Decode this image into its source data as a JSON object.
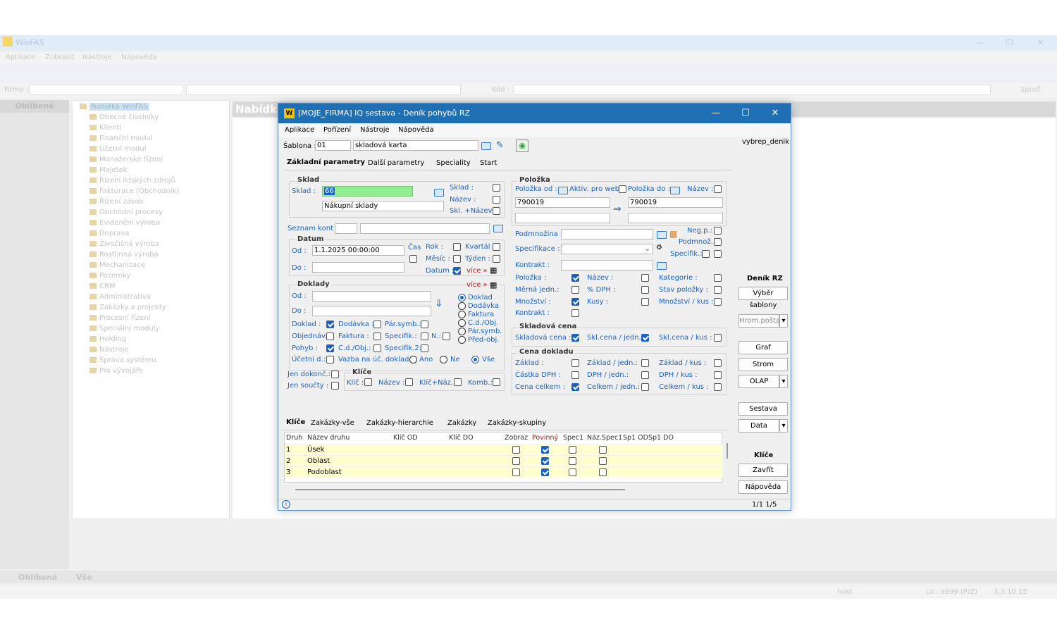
{
  "bg": {
    "title": "WinFAS",
    "menu": [
      "Aplikace",
      "Zobrazit",
      "Nástroje",
      "Nápověda"
    ],
    "firma_label": "Firma :",
    "kod_label": "Kód :",
    "spust": "Spusť",
    "oblibene": "Oblíbené",
    "nabidka": "Nabídka",
    "tree_root": "Nabídka WinFAS",
    "tree": [
      "Obecné číselníky",
      "Klienti",
      "Finanční modul",
      "Účetní modul",
      "Manažerské řízení",
      "Majetek",
      "Řízení lidských zdrojů",
      "Fakturace (Obchodník)",
      "Řízení zásob",
      "Obchodní procesy",
      "Evidenční výroba",
      "Doprava",
      "Živočišná výroba",
      "Rostlinná výroba",
      "Mechanizace",
      "Pozemky",
      "CRM",
      "Administrativa",
      "Zakázky a projekty",
      "Procesní řízení",
      "Speciální moduly",
      "Holding",
      "Nástroje",
      "Správa systému",
      "Pro vývojáře"
    ],
    "footer_left": "Oblíbené",
    "footer_all": "Vše",
    "host": "host",
    "lic": "Lic: 9999 (P/Z)",
    "version": "3.3.10.15"
  },
  "dlg": {
    "title": "[MOJE_FIRMA] IQ sestava - Deník pohybů RZ",
    "menu": [
      "Aplikace",
      "Pořízení",
      "Nástroje",
      "Nápověda"
    ],
    "sablona_label": "Šablona :",
    "sablona_code": "01",
    "sablona_name": "skladová karta",
    "right_code": "vybrep_denik",
    "tabs": [
      "Základní parametry",
      "Další parametry",
      "Speciality",
      "Start"
    ],
    "sklad_group": "Sklad",
    "sklad_label": "Sklad :",
    "sklad_value": "66",
    "sklad_name": "Nákupní sklady",
    "sklad_cb": "Sklad :",
    "nazev_cb": "Název :",
    "sklnazev_cb": "Skl. +Název :",
    "seznam_kont": "Seznam kont :",
    "datum_group": "Datum",
    "od": "Od :",
    "od_value": "1.1.2025 00:00:00",
    "cas": "Čas",
    "do": "Do :",
    "rok": "Rok :",
    "kvartal": "Kvartál :",
    "mesic": "Měsíc :",
    "tyden": "Týden :",
    "datum_cb": "Datum :",
    "vice": "více »",
    "doklady_group": "Doklady",
    "d_od": "Od :",
    "d_do": "Do :",
    "doklad_cb": "Doklad :",
    "dodavka_cb": "Dodávka :",
    "parsymb_cb": "Pár.symb.:",
    "objednav_cb": "Objednáv.:",
    "faktura_cb": "Faktura :",
    "specifik_cb": "Specifik.:",
    "n_cb": "N.:",
    "pohyb_cb": "Pohyb :",
    "cdobj_cb": "C.d./Obj.:",
    "specifik2_cb": "Specifik.2:",
    "ucetni_cb": "Účetní d.:",
    "vazba": "Vazba na úč. doklad :",
    "ano": "Ano",
    "ne": "Ne",
    "vse": "Vše",
    "radios": [
      "Doklad",
      "Dodávka",
      "Faktura",
      "C.d./Obj.",
      "Pár.symb.",
      "Před-obj."
    ],
    "jen_dokonc": "Jen dokonč.:",
    "jen_soucty": "Jen součty :",
    "klice_group": "Klíče",
    "klic": "Klíč :",
    "k_nazev": "Název :",
    "klicnaz": "Klíč+Náz.:",
    "komb": "Komb.:",
    "polozka_group": "Položka",
    "polozka_od": "Položka od :",
    "aktiv_web": "Aktiv. pro web",
    "polozka_do": "Položka do :",
    "p_nazev": "Název :",
    "pol_od_value": "790019",
    "pol_do_value": "790019",
    "podmnozina": "Podmnožina :",
    "negp": "Neg.p.:",
    "podmnoz": "Podmnož. :",
    "specifikace": "Specifikace :",
    "specifik": "Specifik.:",
    "kontrakt": "Kontrakt :",
    "p_polozka": "Položka :",
    "p_nazev2": "Název :",
    "kategorie": "Kategorie :",
    "merna": "Měrná jedn.:",
    "dph": "% DPH :",
    "stav": "Stav položky :",
    "mnozstvi": "Množství :",
    "kusy": "Kusy :",
    "mnozstvi_kus": "Množství / kus :",
    "kontrakt2": "Kontrakt :",
    "skladova_group": "Skladová cena",
    "skladova_cena": "Skladová cena :",
    "sklcena_jedn": "Skl.cena / jedn.:",
    "sklcena_kus": "Skl.cena / kus :",
    "cena_group": "Cena dokladu",
    "zaklad": "Základ :",
    "zaklad_jedn": "Základ / jedn.:",
    "zaklad_kus": "Základ / kus :",
    "castka_dph": "Částka DPH :",
    "dph_jedn": "DPH / jedn.:",
    "dph_kus": "DPH / kus :",
    "cena_celkem": "Cena celkem :",
    "celkem_jedn": "Celkem / jedn.:",
    "celkem_kus": "Celkem / kus :",
    "sidebar": {
      "denik": "Deník RZ",
      "vyber": "Výběr šablony",
      "hrom": "Hrom.pošta",
      "graf": "Graf",
      "strom": "Strom",
      "olap": "OLAP",
      "sestava": "Sestava",
      "data": "Data",
      "klice": "Klíče",
      "zavrit": "Zavřít",
      "napoveda": "Nápověda"
    },
    "bottom_tabs": [
      "Klíče",
      "Zakázky-vše",
      "Zakázky-hierarchie",
      "Zakázky",
      "Zakázky-skupiny"
    ],
    "grid_headers": [
      "Druh",
      "Název druhu",
      "Klíč OD",
      "Klíč DO",
      "Zobraz",
      "Povinný",
      "Spec1",
      "Náz.Spec1",
      "Sp1 OD",
      "Sp1 DO"
    ],
    "grid_rows": [
      {
        "druh": "1",
        "nazev": "Úsek"
      },
      {
        "druh": "2",
        "nazev": "Oblast"
      },
      {
        "druh": "3",
        "nazev": "Podoblast"
      }
    ],
    "status": "1/1  1/5"
  }
}
